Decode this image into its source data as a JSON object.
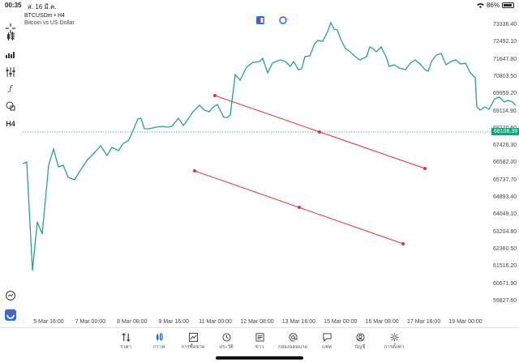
{
  "status": {
    "time": "00:35",
    "date": "ส. 16 มี.ค.",
    "battery": "86%"
  },
  "symbol": {
    "title": "BTCUSDm • H4",
    "subtitle": "Bitcoin vs US Dollar"
  },
  "price_axis": [
    "73336.40",
    "72492.10",
    "71647.80",
    "70803.50",
    "69959.20",
    "69114.90",
    "68270.60",
    "67426.30",
    "66582.00",
    "65737.70",
    "64893.40",
    "64049.10",
    "63204.80",
    "62360.50",
    "61516.20",
    "60671.90",
    "59827.60"
  ],
  "current_price": "68108.39",
  "time_axis": [
    "5 Mar 16:00",
    "7 Mar 00:00",
    "8 Mar 08:00",
    "9 Mar 16:00",
    "11 Mar 00:00",
    "12 Mar 08:00",
    "13 Mar 16:00",
    "15 Mar 00:00",
    "16 Mar 08:00",
    "17 Mar 16:00",
    "19 Mar 00:00"
  ],
  "toolbar_icons": [
    "crosshair-icon",
    "candlestick-icon",
    "indicator-icon",
    "settings-sliders-icon",
    "function-icon",
    "shapes-icon",
    "timeframe-icon"
  ],
  "timeframe": "H4",
  "tabs": [
    {
      "label": "ราคา",
      "icon": "quotes-icon"
    },
    {
      "label": "กราฟ",
      "icon": "chart-icon"
    },
    {
      "label": "การซื้อขาย",
      "icon": "trade-icon"
    },
    {
      "label": "ประวัติ",
      "icon": "history-icon"
    },
    {
      "label": "ข่าว",
      "icon": "news-icon"
    },
    {
      "label": "กล่องจดหมาย",
      "icon": "mailbox-icon"
    },
    {
      "label": "แชท",
      "icon": "chat-icon"
    },
    {
      "label": "บัญชี",
      "icon": "account-icon"
    },
    {
      "label": "การตั้งค่า",
      "icon": "settings-icon"
    }
  ],
  "active_tab": "กราฟ",
  "colors": {
    "line": "#2aa37a",
    "trendline": "#e0303a",
    "price_tag": "#1e9e7a",
    "active": "#1a73e8"
  }
}
